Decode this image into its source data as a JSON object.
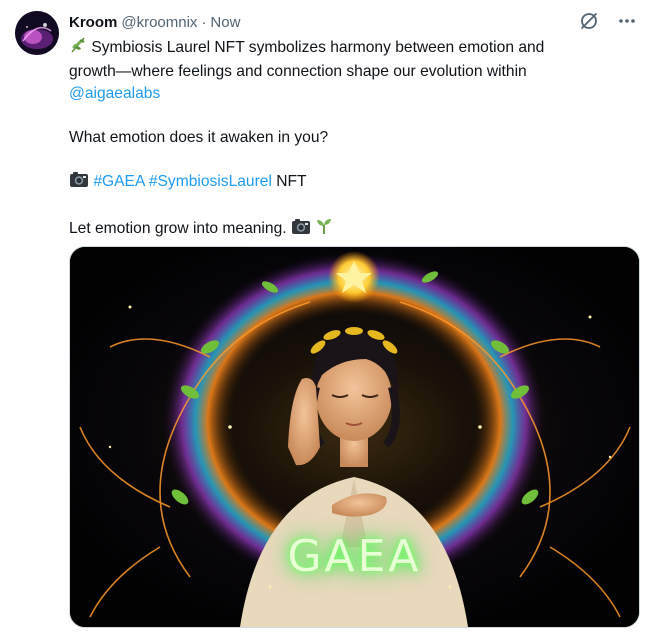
{
  "tweet": {
    "author_name": "Kroom",
    "author_handle": "@kroomnix",
    "separator": "·",
    "time": "Now",
    "line1": "Symbiosis Laurel NFT symbolizes harmony between emotion and",
    "line2": "growth—where feelings and connection shape our evolution within",
    "mention": "@aigaealabs",
    "question": "What emotion does it awaken in you?",
    "hashtag1": "#GAEA",
    "hashtag2": "#SymbiosisLaurel",
    "nft_word": "NFT",
    "closing": "Let emotion grow into meaning.",
    "image_caption": "GAEA"
  },
  "icons": {
    "top": [
      "grok-icon",
      "more-icon"
    ],
    "inline": [
      "herb-emoji",
      "camera-emoji",
      "seedling-emoji"
    ]
  },
  "colors": {
    "link": "#1d9bf0",
    "secondary_text": "#536471",
    "primary_text": "#0f1419",
    "border": "#cfd9de"
  }
}
